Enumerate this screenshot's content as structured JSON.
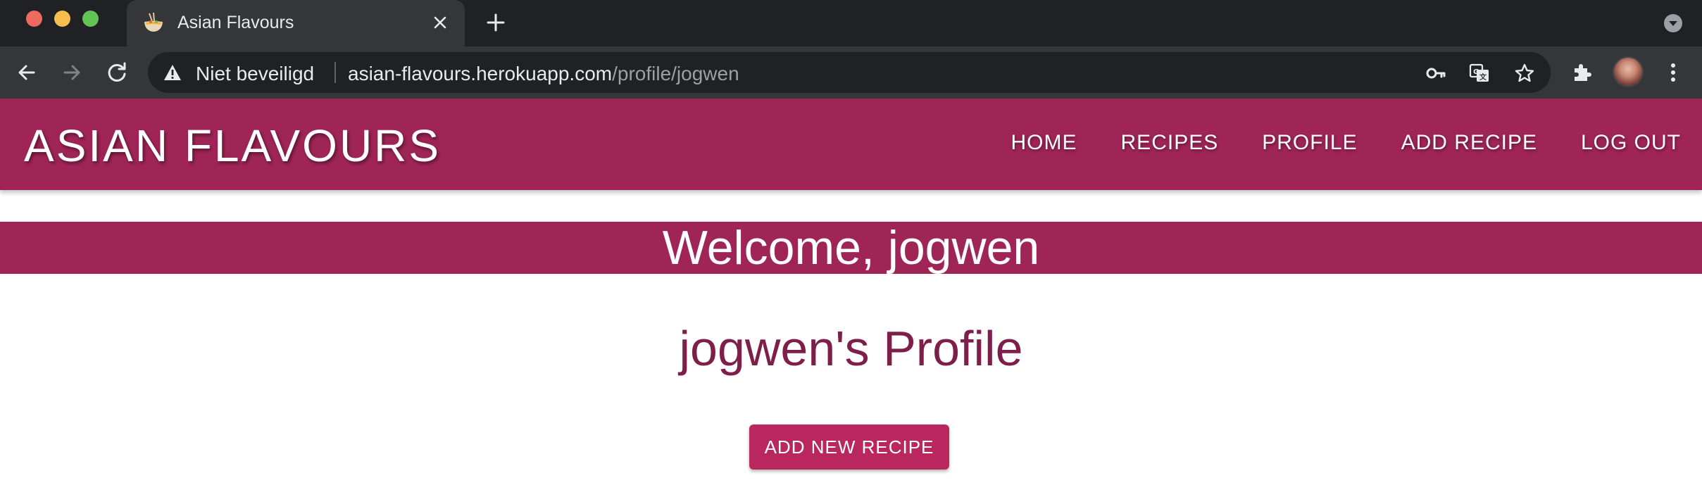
{
  "browser": {
    "tab": {
      "title": "Asian Flavours",
      "favicon": "noodle-bowl-icon"
    },
    "address_bar": {
      "security_label": "Niet beveiligd",
      "url_host": "asian-flavours.herokuapp.com",
      "url_path": "/profile/jogwen"
    },
    "colors": {
      "tabbar": "#202124",
      "toolbar": "#35363a"
    }
  },
  "site": {
    "brand": "ASIAN FLAVOURS",
    "nav": [
      {
        "label": "HOME"
      },
      {
        "label": "RECIPES"
      },
      {
        "label": "PROFILE"
      },
      {
        "label": "ADD RECIPE"
      },
      {
        "label": "LOG OUT"
      }
    ],
    "colors": {
      "primary": "#a02557",
      "heading": "#7d1f4a",
      "button": "#b9275e"
    }
  },
  "main": {
    "welcome": "Welcome, jogwen",
    "profile_title": "jogwen's Profile",
    "add_button_label": "ADD NEW RECIPE"
  }
}
